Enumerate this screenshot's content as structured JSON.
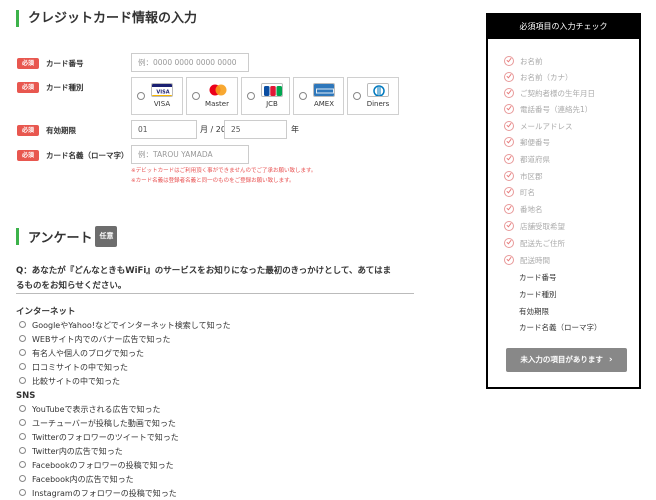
{
  "card_section": {
    "title": "クレジットカード情報の入力",
    "required_badge": "必須",
    "card_number": {
      "label": "カード番号",
      "placeholder": "例：0000 0000 0000 0000"
    },
    "card_type": {
      "label": "カード種別",
      "options": [
        {
          "name": "VISA",
          "logo": "visa-logo-icon",
          "color": "#1a1f71"
        },
        {
          "name": "Master",
          "logo": "mastercard-logo-icon",
          "color": "#eb001b"
        },
        {
          "name": "JCB",
          "logo": "jcb-logo-icon",
          "color": "#0b4ea2"
        },
        {
          "name": "AMEX",
          "logo": "amex-logo-icon",
          "color": "#2e77bb"
        },
        {
          "name": "Diners",
          "logo": "diners-logo-icon",
          "color": "#0079be"
        }
      ]
    },
    "expiry": {
      "label": "有効期限",
      "month": "01",
      "sep": "月 / 20",
      "year": "25",
      "year_suffix": "年"
    },
    "holder": {
      "label": "カード名義（ローマ字）",
      "placeholder": "例：TAROU YAMADA"
    },
    "notes": [
      "※デビットカードはご利用頂く事ができませんのでご了承お願い致します。",
      "※カード名義は登録者名義と同一のものをご登録お願い致します。"
    ]
  },
  "survey": {
    "title": "アンケート",
    "optional_badge": "任意",
    "question_line1": "Q：あなたが『どんなときもWiFi』のサービスをお知りになった最初のきっかけとして、あてはま",
    "question_line2": "るものをお知らせください。",
    "groups": [
      {
        "title": "インターネット",
        "items": [
          "GoogleやYahoo!などでインターネット検索して知った",
          "WEBサイト内でのバナー広告で知った",
          "有名人や個人のブログで知った",
          "口コミサイトの中で知った",
          "比較サイトの中で知った"
        ]
      },
      {
        "title": "SNS",
        "items": [
          "YouTubeで表示される広告で知った",
          "ユーチューバーが投稿した動画で知った",
          "Twitterのフォロワーのツイートで知った",
          "Twitter内の広告で知った",
          "Facebookのフォロワーの投稿で知った",
          "Facebook内の広告で知った",
          "Instagramのフォロワーの投稿で知った"
        ]
      }
    ]
  },
  "panel": {
    "title": "必須項目の入力チェック",
    "completed": [
      "お名前",
      "お名前（カナ）",
      "ご契約者様の生年月日",
      "電話番号（連絡先1）",
      "メールアドレス",
      "郵便番号",
      "都道府県",
      "市区郡",
      "町名",
      "番地名",
      "店舗受取希望",
      "配送先ご住所",
      "配送時間"
    ],
    "pending": [
      "カード番号",
      "カード種別",
      "有効期限",
      "カード名義（ローマ字）"
    ],
    "button_label": "未入力の項目があります",
    "check_color": "#e87a7a",
    "accent_color": "#3cb24a"
  }
}
